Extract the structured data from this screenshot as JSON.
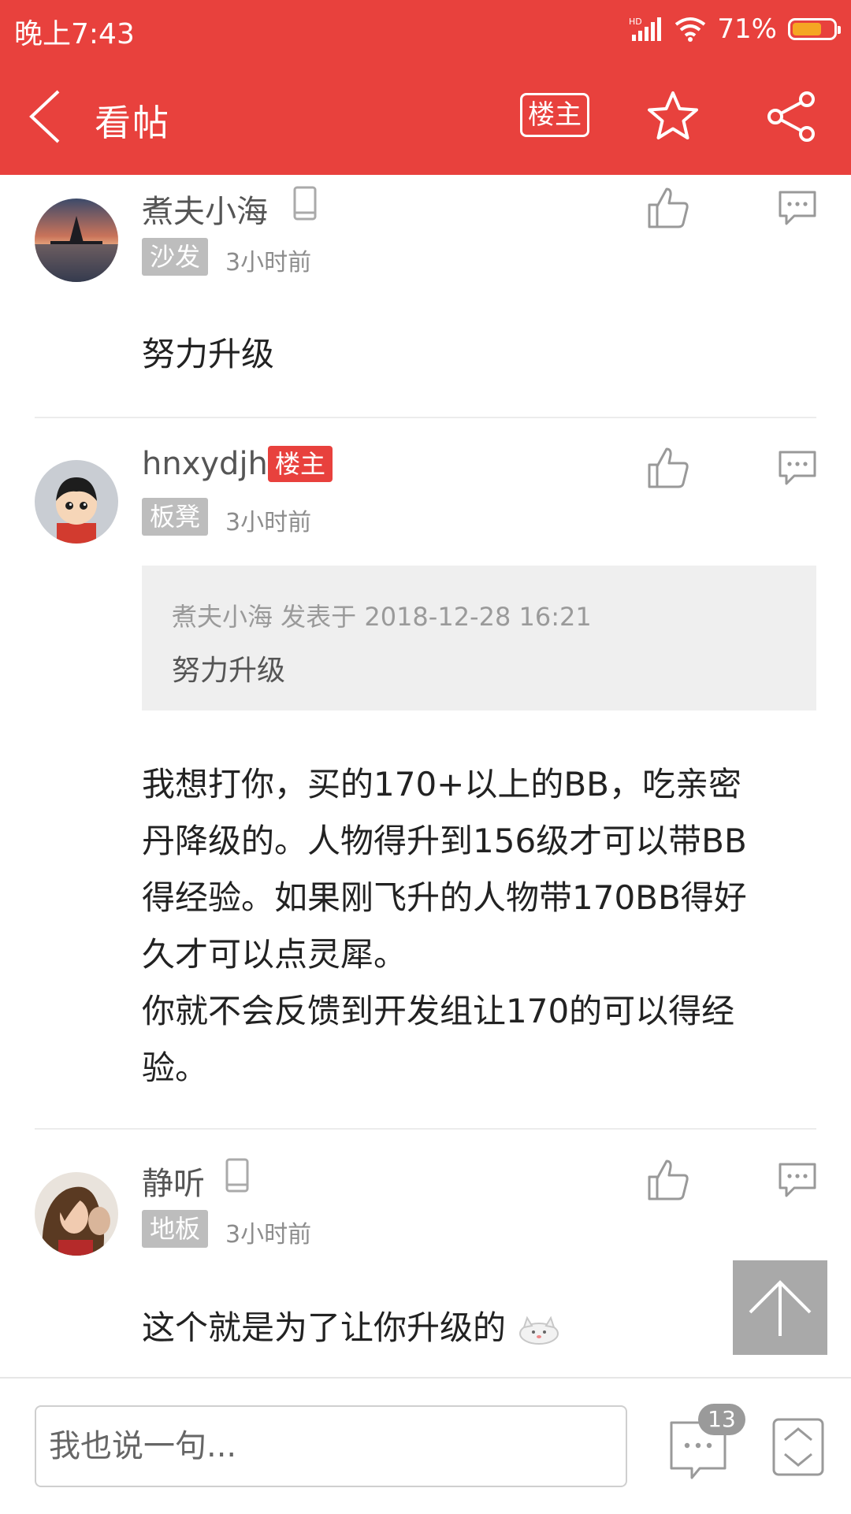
{
  "status_bar": {
    "time": "晚上7:43",
    "network": "HD",
    "battery_percent": "71%",
    "battery_level": 0.71
  },
  "toolbar": {
    "title": "看帖",
    "owner_button": "楼主",
    "icons": [
      "back-arrow-icon",
      "star-icon",
      "share-icon"
    ]
  },
  "posts": [
    {
      "username": "煮夫小海",
      "floor_tag": "沙发",
      "time": "3小时前",
      "device": "phone-icon",
      "content": "努力升级"
    },
    {
      "username": "hnxydjh",
      "owner_badge": "楼主",
      "floor_tag": "板凳",
      "time": "3小时前",
      "quote": {
        "meta": "煮夫小海 发表于 2018-12-28 16:21",
        "text": "努力升级"
      },
      "content_lines": [
        "我想打你，买的170+以上的BB，吃亲密",
        "丹降级的。人物得升到156级才可以带BB",
        "得经验。如果刚飞升的人物带170BB得好",
        "久才可以点灵犀。",
        "你就不会反馈到开发组让170的可以得经",
        "验。"
      ]
    },
    {
      "username": "静听",
      "floor_tag": "地板",
      "time": "3小时前",
      "device": "phone-icon",
      "content": "这个就是为了让你升级的"
    }
  ],
  "bottom_bar": {
    "input_placeholder": "我也说一句...",
    "comment_count": "13"
  },
  "colors": {
    "brand_red": "#e8413d",
    "tag_gray": "#bdbdbd"
  }
}
